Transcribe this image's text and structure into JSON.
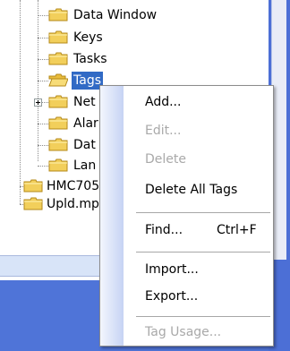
{
  "tree": {
    "items": [
      {
        "label": "Data Window"
      },
      {
        "label": "Keys"
      },
      {
        "label": "Tasks"
      },
      {
        "label": "Tags"
      },
      {
        "label": "Net"
      },
      {
        "label": "Alar"
      },
      {
        "label": "Dat"
      },
      {
        "label": "Lan"
      },
      {
        "label": "HMC705"
      },
      {
        "label": "Upld.mp"
      }
    ]
  },
  "context_menu": {
    "items": [
      {
        "label": "Add...",
        "enabled": true
      },
      {
        "label": "Edit...",
        "enabled": false
      },
      {
        "label": "Delete",
        "enabled": false
      },
      {
        "label": "Delete All Tags",
        "enabled": true
      },
      {
        "label": "Find...",
        "shortcut": "Ctrl+F",
        "enabled": true
      },
      {
        "label": "Import...",
        "enabled": true
      },
      {
        "label": "Export...",
        "enabled": true
      },
      {
        "label": "Tag Usage...",
        "enabled": false
      }
    ]
  },
  "colors": {
    "selection": "#316ac5",
    "folder": "#f2cf5b",
    "panel_blue": "#4f74d8"
  }
}
